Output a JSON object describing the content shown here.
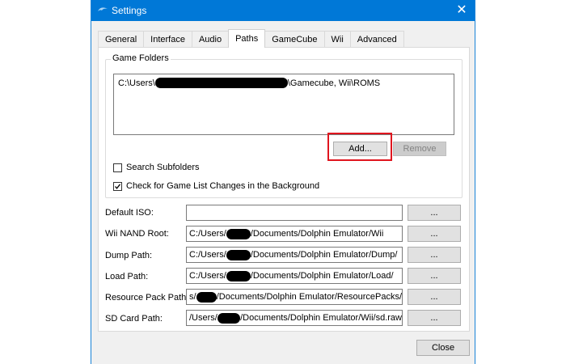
{
  "window": {
    "title": "Settings",
    "close_glyph": "✕"
  },
  "tabs": [
    {
      "label": "General",
      "active": false
    },
    {
      "label": "Interface",
      "active": false
    },
    {
      "label": "Audio",
      "active": false
    },
    {
      "label": "Paths",
      "active": true
    },
    {
      "label": "GameCube",
      "active": false
    },
    {
      "label": "Wii",
      "active": false
    },
    {
      "label": "Advanced",
      "active": false
    }
  ],
  "game_folders": {
    "title": "Game Folders",
    "items": [
      {
        "prefix": "C:\\Users\\",
        "suffix": "\\Gamecube, Wii\\ROMS"
      }
    ],
    "add_label": "Add...",
    "remove_label": "Remove",
    "search_subfolders": {
      "label": "Search Subfolders",
      "checked": false
    },
    "check_changes": {
      "label": "Check for Game List Changes in the Background",
      "checked": true
    }
  },
  "paths": {
    "default_iso": {
      "label": "Default ISO:",
      "prefix": "",
      "suffix": ""
    },
    "wii_nand_root": {
      "label": "Wii NAND Root:",
      "prefix": "C:/Users/",
      "suffix": "/Documents/Dolphin Emulator/Wii"
    },
    "dump_path": {
      "label": "Dump Path:",
      "prefix": "C:/Users/",
      "suffix": "/Documents/Dolphin Emulator/Dump/"
    },
    "load_path": {
      "label": "Load Path:",
      "prefix": "C:/Users/",
      "suffix": "/Documents/Dolphin Emulator/Load/"
    },
    "resource_pack_path": {
      "label": "Resource Pack Path:",
      "prefix": "s/",
      "suffix": "/Documents/Dolphin Emulator/ResourcePacks/"
    },
    "sd_card_path": {
      "label": "SD Card Path:",
      "prefix": "/Users/",
      "suffix": "/Documents/Dolphin Emulator/Wii/sd.raw"
    },
    "browse_label": "..."
  },
  "footer": {
    "close_label": "Close"
  },
  "colors": {
    "titlebar": "#0078d7",
    "highlight": "#e0151e"
  }
}
